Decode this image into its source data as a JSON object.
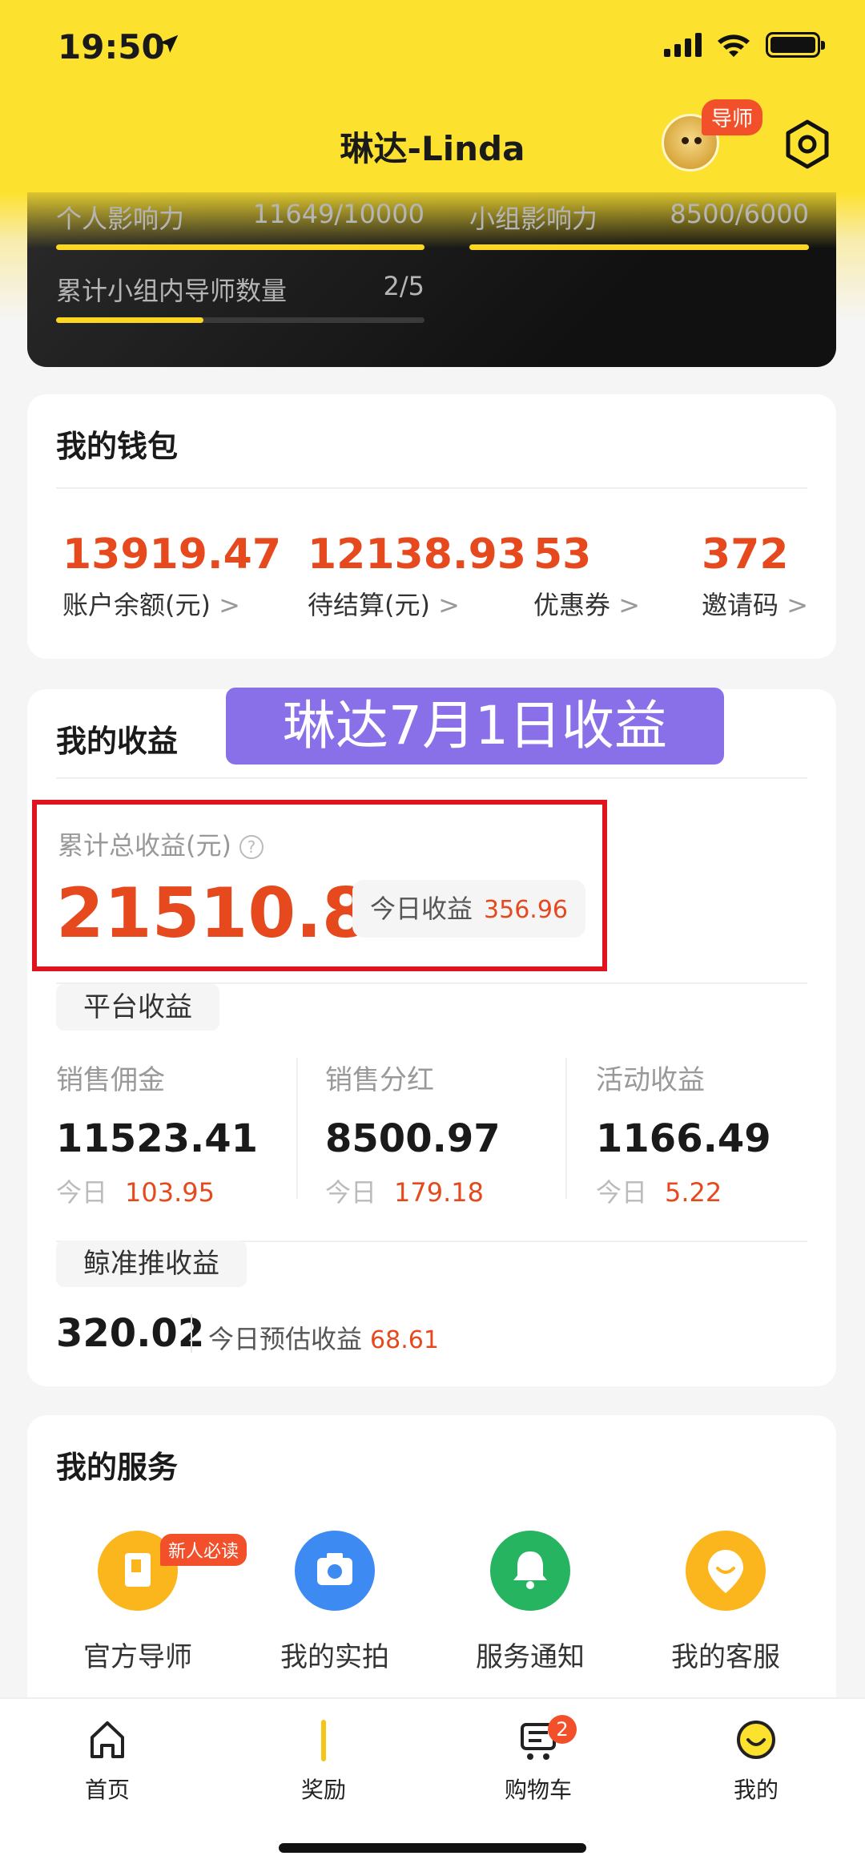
{
  "status_bar": {
    "time": "19:50"
  },
  "header": {
    "title": "琳达-Linda",
    "mentor_badge": "导师"
  },
  "influence": {
    "personal_label": "个人影响力",
    "personal_value": "11649/10000",
    "personal_progress": 1.0,
    "group_label": "小组影响力",
    "group_value": "8500/6000",
    "group_progress": 1.0,
    "mentors_label": "累计小组内导师数量",
    "mentors_value": "2/5",
    "mentors_progress": 0.4
  },
  "wallet": {
    "title": "我的钱包",
    "items": [
      {
        "value": "13919.47",
        "label": "账户余额(元)"
      },
      {
        "value": "12138.93",
        "label": "待结算(元)"
      },
      {
        "value": "53",
        "label": "优惠券"
      },
      {
        "value": "372",
        "label": "邀请码"
      }
    ],
    "chevron": ">"
  },
  "earnings": {
    "title": "我的收益",
    "overlay_text": "琳达7月1日收益",
    "total_label": "累计总收益(元)",
    "help_mark": "?",
    "total_value": "21510.89",
    "today_label": "今日收益",
    "today_value": "356.96",
    "platform_tag": "平台收益",
    "columns": [
      {
        "title": "销售佣金",
        "value": "11523.41",
        "today_label": "今日",
        "today_value": "103.95"
      },
      {
        "title": "销售分红",
        "value": "8500.97",
        "today_label": "今日",
        "today_value": "179.18"
      },
      {
        "title": "活动收益",
        "value": "1166.49",
        "today_label": "今日",
        "today_value": "5.22"
      }
    ],
    "whale_tag": "鲸准推收益",
    "whale_value": "320.02",
    "whale_today_label": "今日预估收益",
    "whale_today_value": "68.61"
  },
  "services": {
    "title": "我的服务",
    "new_badge": "新人必读",
    "items": [
      {
        "label": "官方导师",
        "icon": "book-icon",
        "color": "#fbb51d"
      },
      {
        "label": "我的实拍",
        "icon": "camera-icon",
        "color": "#3d8bf2"
      },
      {
        "label": "服务通知",
        "icon": "bell-icon",
        "color": "#26b461"
      },
      {
        "label": "我的客服",
        "icon": "smile-chat-icon",
        "color": "#fbb51d"
      }
    ]
  },
  "tabbar": {
    "items": [
      {
        "label": "首页",
        "icon": "home-icon"
      },
      {
        "label": "奖励",
        "icon": "reward-icon"
      },
      {
        "label": "购物车",
        "icon": "cart-icon",
        "badge": "2"
      },
      {
        "label": "我的",
        "icon": "smile-icon"
      }
    ]
  },
  "colors": {
    "brand_yellow": "#fde12f",
    "accent_orange": "#e5491d",
    "overlay_purple": "#8a70e8",
    "highlight_red": "#e0141f"
  }
}
